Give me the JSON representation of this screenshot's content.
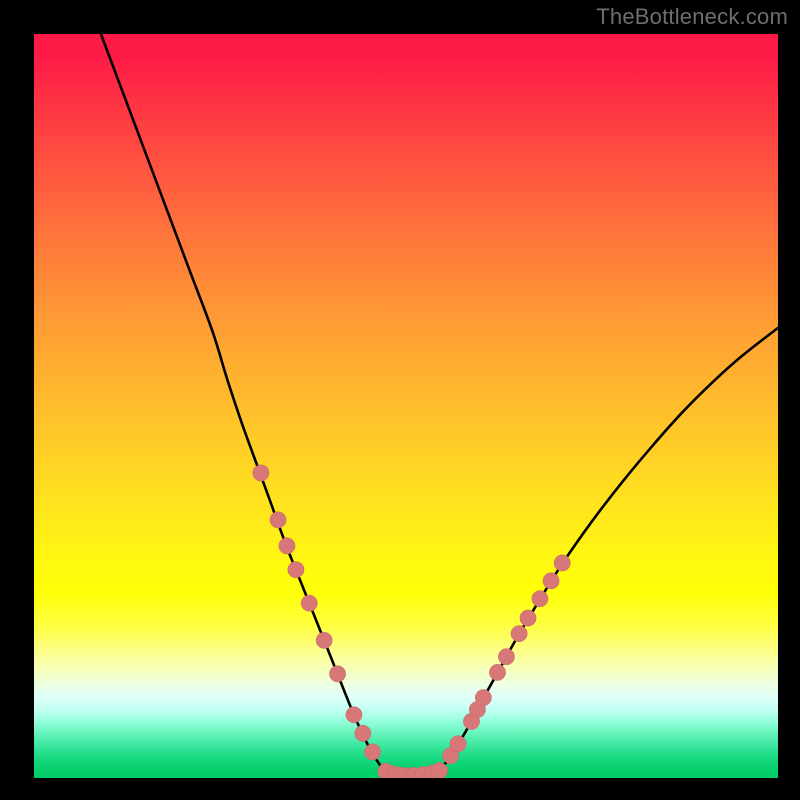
{
  "watermark": "TheBottleneck.com",
  "colors": {
    "curve": "#000000",
    "marker_fill": "#d77777",
    "marker_stroke": "#c96868",
    "background_border": "#000000"
  },
  "chart_data": {
    "type": "line",
    "title": "",
    "xlabel": "",
    "ylabel": "",
    "xlim": [
      0,
      100
    ],
    "ylim": [
      0,
      100
    ],
    "grid": false,
    "legend": null,
    "series": [
      {
        "name": "left-branch",
        "x": [
          9,
          12,
          15,
          18,
          21,
          24,
          26,
          28,
          30,
          32,
          34,
          36,
          38,
          40,
          41.5,
          43,
          44.5,
          46,
          47.3
        ],
        "y": [
          100,
          92,
          84,
          76,
          68,
          60,
          53.5,
          47.5,
          42,
          36.5,
          31,
          26,
          21,
          16,
          12.2,
          8.5,
          5.2,
          2.5,
          0.8
        ]
      },
      {
        "name": "valley-floor",
        "x": [
          47.3,
          48.5,
          50,
          51.5,
          53,
          54.3
        ],
        "y": [
          0.8,
          0.4,
          0.3,
          0.35,
          0.45,
          0.8
        ]
      },
      {
        "name": "right-branch",
        "x": [
          54.3,
          56,
          58,
          60,
          62.5,
          65,
          68,
          71,
          75,
          79,
          83,
          87,
          91,
          95,
          100
        ],
        "y": [
          0.8,
          3.0,
          6.2,
          10.0,
          14.5,
          19.0,
          24.0,
          28.8,
          34.5,
          39.7,
          44.5,
          49.0,
          53.0,
          56.6,
          60.5
        ]
      }
    ],
    "markers": {
      "name": "highlight-points",
      "shape": "circle",
      "radius_chart_units": 1.1,
      "points": [
        {
          "x": 30.5,
          "y": 41.0
        },
        {
          "x": 32.8,
          "y": 34.7
        },
        {
          "x": 34.0,
          "y": 31.2
        },
        {
          "x": 35.2,
          "y": 28.0
        },
        {
          "x": 37.0,
          "y": 23.5
        },
        {
          "x": 39.0,
          "y": 18.5
        },
        {
          "x": 40.8,
          "y": 14.0
        },
        {
          "x": 43.0,
          "y": 8.5
        },
        {
          "x": 44.2,
          "y": 6.0
        },
        {
          "x": 45.5,
          "y": 3.5
        },
        {
          "x": 47.3,
          "y": 0.9
        },
        {
          "x": 48.5,
          "y": 0.5
        },
        {
          "x": 49.7,
          "y": 0.35
        },
        {
          "x": 51.0,
          "y": 0.35
        },
        {
          "x": 52.3,
          "y": 0.45
        },
        {
          "x": 53.5,
          "y": 0.65
        },
        {
          "x": 54.5,
          "y": 1.0
        },
        {
          "x": 56.0,
          "y": 3.0
        },
        {
          "x": 57.0,
          "y": 4.6
        },
        {
          "x": 58.8,
          "y": 7.6
        },
        {
          "x": 59.6,
          "y": 9.2
        },
        {
          "x": 60.4,
          "y": 10.8
        },
        {
          "x": 62.3,
          "y": 14.2
        },
        {
          "x": 63.5,
          "y": 16.3
        },
        {
          "x": 65.2,
          "y": 19.4
        },
        {
          "x": 66.4,
          "y": 21.5
        },
        {
          "x": 68.0,
          "y": 24.1
        },
        {
          "x": 69.5,
          "y": 26.5
        },
        {
          "x": 71.0,
          "y": 28.9
        }
      ]
    }
  }
}
